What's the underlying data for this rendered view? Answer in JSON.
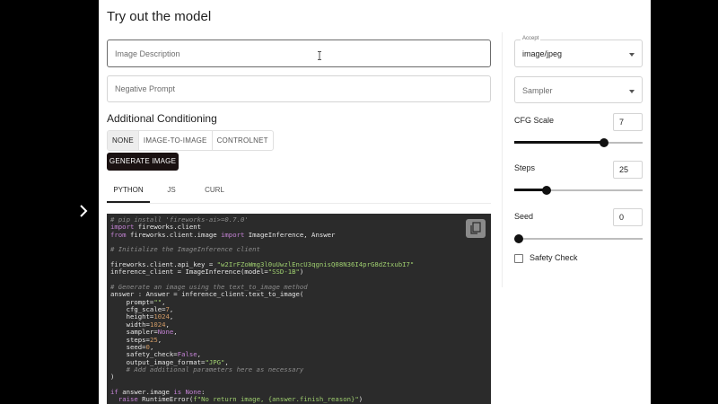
{
  "page": {
    "title": "Try out the model"
  },
  "prompt": {
    "image_description_placeholder": "Image Description",
    "negative_prompt_placeholder": "Negative Prompt"
  },
  "conditioning": {
    "title": "Additional Conditioning",
    "options": [
      "NONE",
      "IMAGE-TO-IMAGE",
      "CONTROLNET"
    ],
    "selected": "NONE"
  },
  "generate_button": "GENERATE IMAGE",
  "code_tabs": [
    "PYTHON",
    "JS",
    "CURL"
  ],
  "code_tab_selected": "PYTHON",
  "code": {
    "install_comment": "# pip install 'fireworks-ai>=0.7.0'",
    "api_key": "w2IrFZoWmg3l0uUwzlEncU3qgnisQ08N36I4prG8dZtxubI7",
    "model": "SSD-1B"
  },
  "settings": {
    "accept_label": "Accept",
    "accept_value": "image/jpeg",
    "sampler_placeholder": "Sampler",
    "cfg_scale": {
      "label": "CFG Scale",
      "value": "7",
      "min": 0,
      "max": 10,
      "level": 7
    },
    "steps": {
      "label": "Steps",
      "value": "25",
      "min": 0,
      "max": 100,
      "level": 25
    },
    "seed": {
      "label": "Seed",
      "value": "0",
      "min": 0,
      "max": 100,
      "level": 0
    },
    "safety_check_label": "Safety Check",
    "safety_check_checked": false
  },
  "icons": {
    "expander": "chevron-right-icon",
    "select_arrow": "caret-down-icon",
    "copy": "copy-icon",
    "text_cursor": "i-beam-cursor-icon"
  }
}
